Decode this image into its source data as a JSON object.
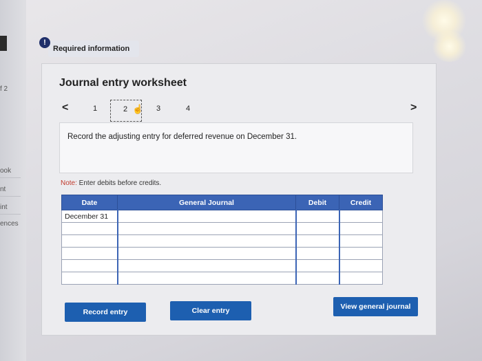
{
  "sidebar": {
    "items": [
      {
        "label": "f 2"
      },
      {
        "label": "ook"
      },
      {
        "label": "nt"
      },
      {
        "label": "int"
      },
      {
        "label": "ences"
      }
    ]
  },
  "header": {
    "badge": "!",
    "required_label": "Required information"
  },
  "worksheet": {
    "title": "Journal entry worksheet",
    "nav": {
      "prev": "<",
      "next": ">",
      "pages": [
        "1",
        "2",
        "3",
        "4"
      ],
      "current_page": "2"
    },
    "instruction": "Record the adjusting entry for deferred revenue on December 31.",
    "note_prefix": "Note:",
    "note_text": " Enter debits before credits.",
    "table": {
      "headers": {
        "date": "Date",
        "general_journal": "General Journal",
        "debit": "Debit",
        "credit": "Credit"
      },
      "rows": [
        {
          "date": "December 31",
          "account": "",
          "debit": "",
          "credit": ""
        },
        {
          "date": "",
          "account": "",
          "debit": "",
          "credit": ""
        },
        {
          "date": "",
          "account": "",
          "debit": "",
          "credit": ""
        },
        {
          "date": "",
          "account": "",
          "debit": "",
          "credit": ""
        },
        {
          "date": "",
          "account": "",
          "debit": "",
          "credit": ""
        },
        {
          "date": "",
          "account": "",
          "debit": "",
          "credit": ""
        }
      ]
    },
    "buttons": {
      "record": "Record entry",
      "clear": "Clear entry",
      "view_journal": "View general journal"
    }
  },
  "colors": {
    "accent": "#1d5fb0",
    "header_blue": "#3b64b5",
    "badge": "#1f2f6a"
  }
}
